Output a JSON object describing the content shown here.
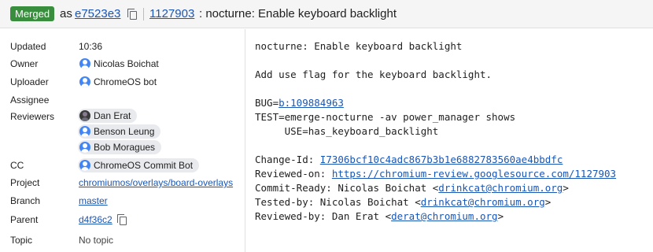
{
  "header": {
    "status_badge": "Merged",
    "as_label": "as",
    "commit": "e7523e3",
    "change_number": "1127903",
    "title": ": nocturne: Enable keyboard backlight"
  },
  "info": {
    "updated": {
      "label": "Updated",
      "value": "10:36"
    },
    "owner": {
      "label": "Owner",
      "value": "Nicolas Boichat"
    },
    "uploader": {
      "label": "Uploader",
      "value": "ChromeOS bot"
    },
    "assignee": {
      "label": "Assignee"
    },
    "reviewers": {
      "label": "Reviewers",
      "people": [
        "Dan Erat",
        "Benson Leung",
        "Bob Moragues"
      ]
    },
    "cc": {
      "label": "CC",
      "people": [
        "ChromeOS Commit Bot"
      ]
    },
    "project": {
      "label": "Project",
      "value": "chromiumos/overlays/board-overlays"
    },
    "branch": {
      "label": "Branch",
      "value": "master"
    },
    "parent": {
      "label": "Parent",
      "value": "d4f36c2"
    },
    "topic": {
      "label": "Topic",
      "value": "No topic"
    }
  },
  "commit_message": {
    "subject": "nocturne: Enable keyboard backlight",
    "body": "Add use flag for the keyboard backlight.",
    "bug_label": "BUG=",
    "bug_link": "b:109884963",
    "test_line1": "TEST=emerge-nocturne -av power_manager shows",
    "test_line2": "     USE=has_keyboard_backlight",
    "change_id_label": "Change-Id: ",
    "change_id": "I7306bcf10c4adc867b3b1e6882783560ae4bbdfc",
    "reviewed_on_label": "Reviewed-on: ",
    "reviewed_on": "https://chromium-review.googlesource.com/1127903",
    "commit_ready_label": "Commit-Ready: Nicolas Boichat <",
    "commit_ready_email": "drinkcat@chromium.org",
    "tested_by_label": "Tested-by: Nicolas Boichat <",
    "tested_by_email": "drinkcat@chromium.org",
    "reviewed_by_label": "Reviewed-by: Dan Erat <",
    "reviewed_by_email": "derat@chromium.org",
    "close": ">"
  }
}
